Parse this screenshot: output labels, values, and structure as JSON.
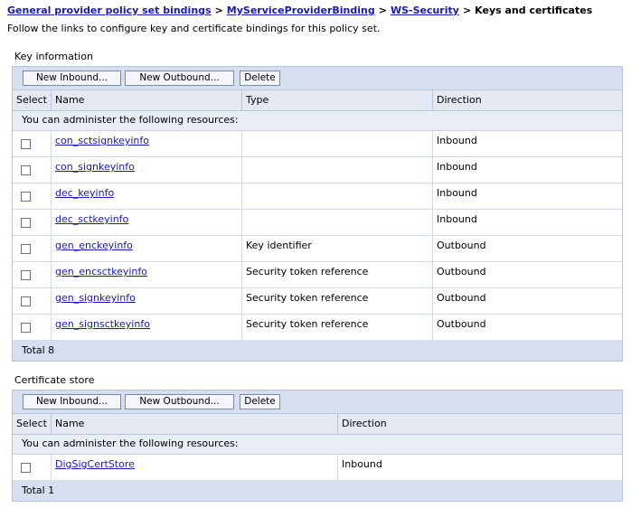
{
  "breadcrumb": {
    "items": [
      "General provider policy set bindings",
      "MyServiceProviderBinding",
      "WS-Security"
    ],
    "separator": ">",
    "current": "Keys and certificates"
  },
  "intro": "Follow the links to configure key and certificate bindings for this policy set.",
  "key_section": {
    "title": "Key information",
    "buttons": {
      "new_inbound": "New Inbound...",
      "new_outbound": "New Outbound...",
      "delete": "Delete"
    },
    "columns": {
      "select": "Select",
      "name": "Name",
      "type": "Type",
      "direction": "Direction"
    },
    "info": "You can administer the following resources:",
    "rows": [
      {
        "name": "con_sctsignkeyinfo",
        "type": "",
        "direction": "Inbound"
      },
      {
        "name": "con_signkeyinfo",
        "type": "",
        "direction": "Inbound"
      },
      {
        "name": "dec_keyinfo",
        "type": "",
        "direction": "Inbound"
      },
      {
        "name": "dec_sctkeyinfo",
        "type": "",
        "direction": "Inbound"
      },
      {
        "name": "gen_enckeyinfo",
        "type": "Key identifier",
        "direction": "Outbound"
      },
      {
        "name": "gen_encsctkeyinfo",
        "type": "Security token reference",
        "direction": "Outbound"
      },
      {
        "name": "gen_signkeyinfo",
        "type": "Security token reference",
        "direction": "Outbound"
      },
      {
        "name": "gen_signsctkeyinfo",
        "type": "Security token reference",
        "direction": "Outbound"
      }
    ],
    "total": "Total 8"
  },
  "cert_section": {
    "title": "Certificate store",
    "buttons": {
      "new_inbound": "New Inbound...",
      "new_outbound": "New Outbound...",
      "delete": "Delete"
    },
    "columns": {
      "select": "Select",
      "name": "Name",
      "direction": "Direction"
    },
    "info": "You can administer the following resources:",
    "rows": [
      {
        "name": "DigSigCertStore",
        "direction": "Inbound"
      }
    ],
    "total": "Total 1"
  }
}
